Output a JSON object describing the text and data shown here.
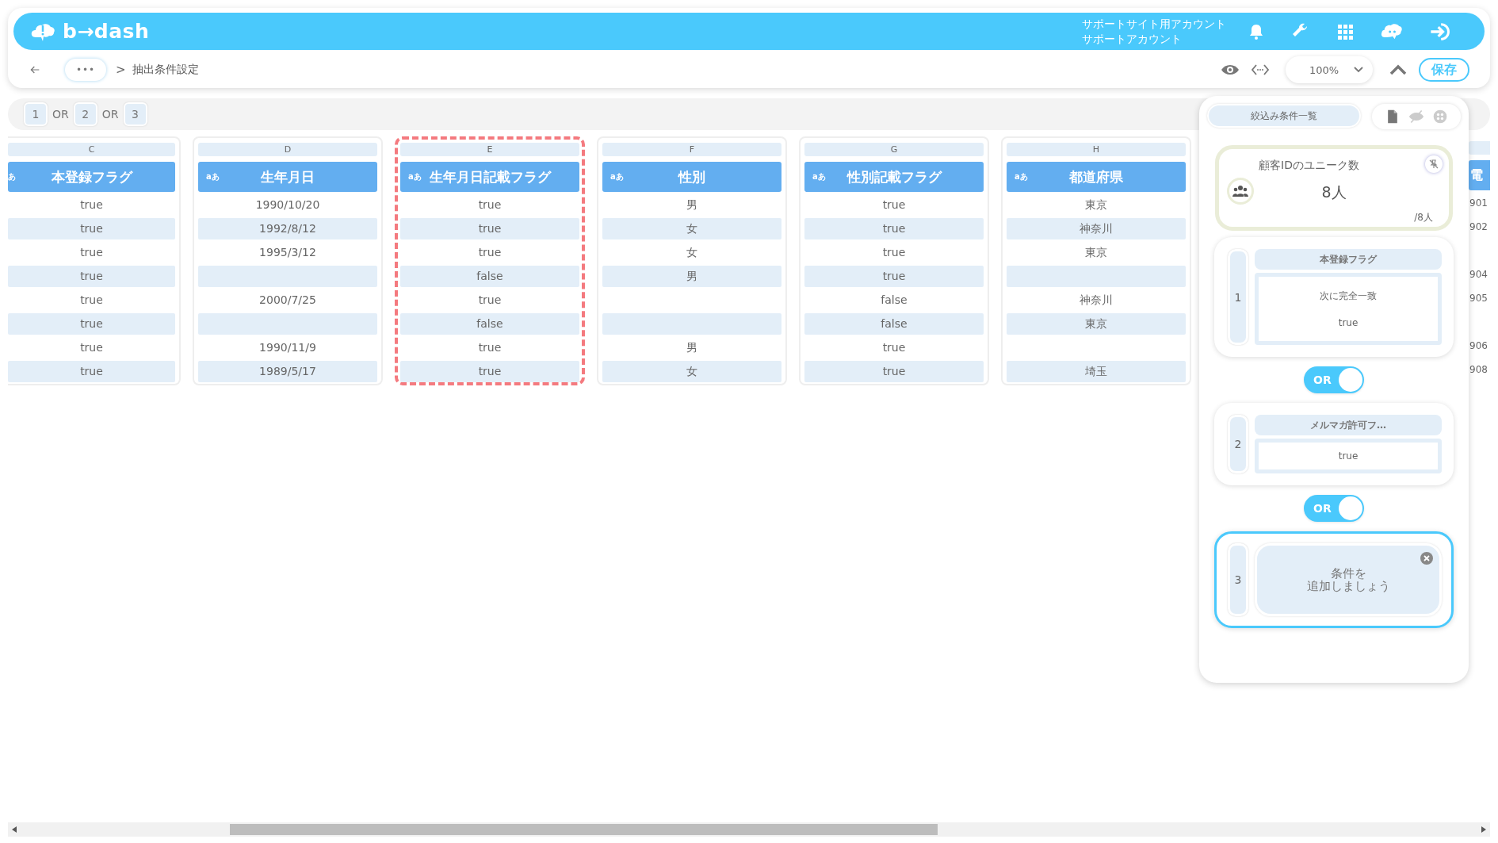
{
  "header": {
    "logo": "b→dash",
    "account_lines": [
      "サポートサイト用アカウント",
      "サポートアカウント"
    ]
  },
  "toolbar": {
    "breadcrumb_more": "•••",
    "separator": ">",
    "page_title": "抽出条件設定",
    "zoom": "100%",
    "save": "保存"
  },
  "filter_expression": [
    {
      "kind": "chip",
      "label": "1"
    },
    {
      "kind": "op",
      "label": "OR"
    },
    {
      "kind": "chip",
      "label": "2"
    },
    {
      "kind": "op",
      "label": "OR"
    },
    {
      "kind": "chip",
      "label": "3"
    }
  ],
  "columns": [
    {
      "letter": "C",
      "type_badge": "あ",
      "title": "本登録フラグ",
      "highlighted": false,
      "cells": [
        "true",
        "true",
        "true",
        "true",
        "true",
        "true",
        "true",
        "true"
      ]
    },
    {
      "letter": "D",
      "type_badge": "aあ",
      "title": "生年月日",
      "highlighted": false,
      "cells": [
        "1990/10/20",
        "1992/8/12",
        "1995/3/12",
        "",
        "2000/7/25",
        "",
        "1990/11/9",
        "1989/5/17"
      ]
    },
    {
      "letter": "E",
      "type_badge": "aあ",
      "title": "生年月日記載フラグ",
      "highlighted": true,
      "cells": [
        "true",
        "true",
        "true",
        "false",
        "true",
        "false",
        "true",
        "true"
      ]
    },
    {
      "letter": "F",
      "type_badge": "aあ",
      "title": "性別",
      "highlighted": false,
      "cells": [
        "男",
        "女",
        "女",
        "男",
        "",
        "",
        "男",
        "女"
      ]
    },
    {
      "letter": "G",
      "type_badge": "aあ",
      "title": "性別記載フラグ",
      "highlighted": false,
      "cells": [
        "true",
        "true",
        "true",
        "true",
        "false",
        "false",
        "true",
        "true"
      ]
    },
    {
      "letter": "H",
      "type_badge": "aあ",
      "title": "都道府県",
      "highlighted": false,
      "cells": [
        "東京",
        "神奈川",
        "東京",
        "",
        "神奈川",
        "東京",
        "",
        "埼玉"
      ]
    }
  ],
  "partial_column": {
    "title": "電",
    "cells": [
      "901",
      "902",
      "",
      "904",
      "905",
      "",
      "906",
      "908"
    ]
  },
  "panel": {
    "tab": "絞込み条件一覧",
    "summary": {
      "label": "顧客IDのユニーク数",
      "count": "8人",
      "total": "/8人"
    },
    "conditions": [
      {
        "kind": "filled",
        "number": "1",
        "field": "本登録フラグ",
        "operator": "次に完全一致",
        "value": "true",
        "selected": false
      },
      {
        "kind": "filled",
        "number": "2",
        "field": "メルマガ許可フ…",
        "value": "true",
        "selected": false
      },
      {
        "kind": "empty",
        "number": "3",
        "prompt_lines": [
          "条件を",
          "追加しましょう"
        ],
        "selected": true
      }
    ],
    "connectors": [
      {
        "label": "OR",
        "on": true
      },
      {
        "label": "OR",
        "on": true
      }
    ]
  }
}
